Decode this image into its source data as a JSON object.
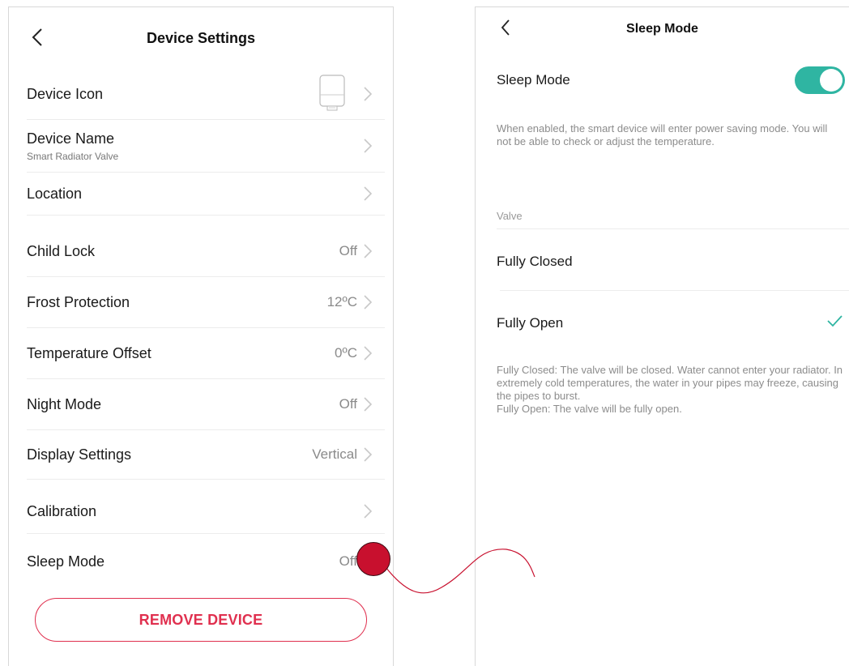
{
  "left": {
    "title": "Device Settings",
    "rows": [
      {
        "label": "Device Icon",
        "value": ""
      },
      {
        "label": "Device Name",
        "sub": "Smart Radiator Valve",
        "value": ""
      },
      {
        "label": "Location",
        "value": ""
      },
      {
        "label": "Child Lock",
        "value": "Off"
      },
      {
        "label": "Frost Protection",
        "value": "12ºC"
      },
      {
        "label": "Temperature Offset",
        "value": "0ºC"
      },
      {
        "label": "Night Mode",
        "value": "Off"
      },
      {
        "label": "Display Settings",
        "value": "Vertical"
      },
      {
        "label": "Calibration",
        "value": ""
      },
      {
        "label": "Sleep Mode",
        "value": "Off"
      }
    ],
    "remove_label": "REMOVE DEVICE"
  },
  "right": {
    "title": "Sleep Mode",
    "sleep_label": "Sleep Mode",
    "sleep_enabled": true,
    "description": "When enabled, the smart device will enter power saving mode. You will not be able to check or adjust the temperature.",
    "section_label": "Valve",
    "options": [
      {
        "label": "Fully Closed",
        "selected": false
      },
      {
        "label": "Fully Open",
        "selected": true
      }
    ],
    "note_line1": "Fully Closed: The valve will be closed. Water cannot enter your radiator. In extremely cold temperatures, the water in your pipes may freeze, causing the pipes to burst.",
    "note_line2": "Fully Open: The valve will be fully open."
  },
  "colors": {
    "accent_red": "#e0304f",
    "toggle_teal": "#2fb5a2",
    "callout_red": "#c8102e"
  },
  "icons": {
    "back": "chevron-left-icon",
    "row_arrow": "chevron-right-icon",
    "selected": "checkmark-icon",
    "device": "radiator-valve-icon"
  }
}
